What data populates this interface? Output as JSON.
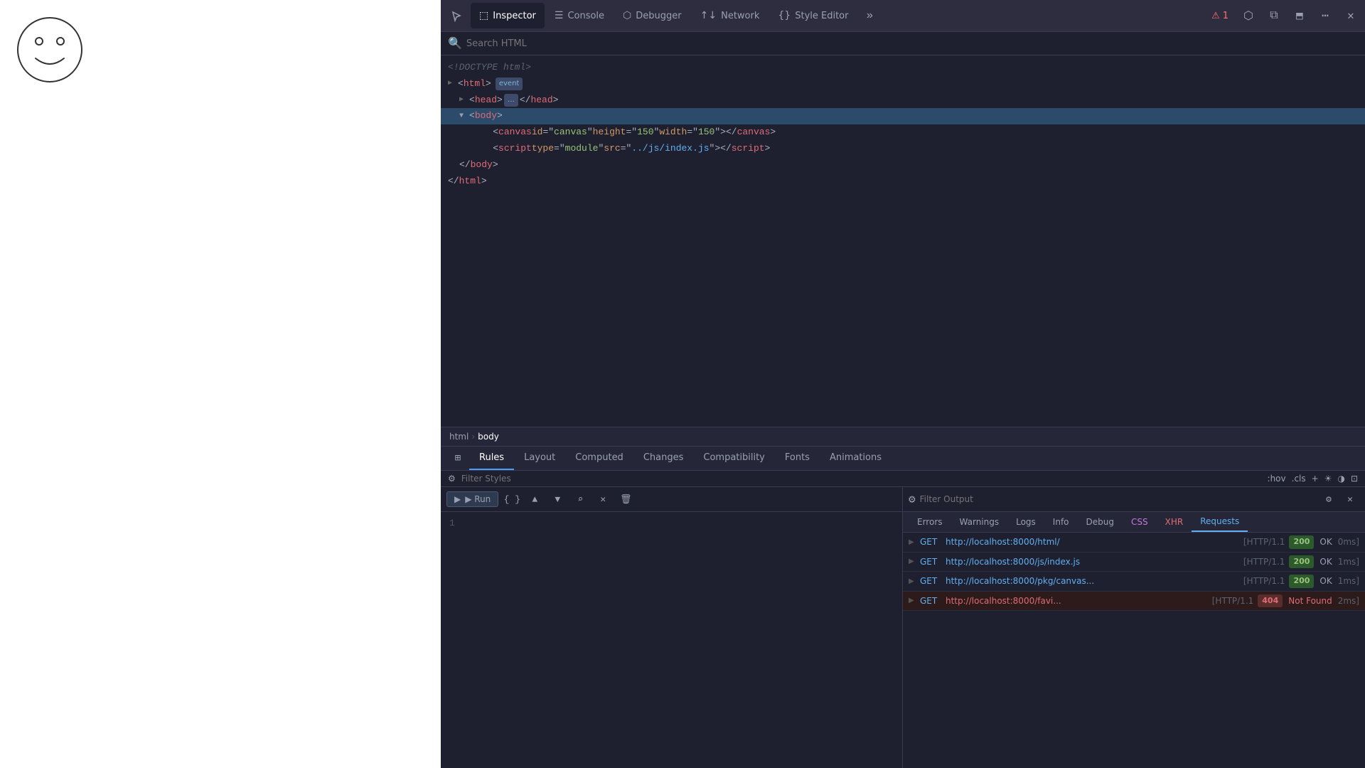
{
  "viewport": {
    "smiley_label": "smiley face"
  },
  "toolbar": {
    "tabs": [
      {
        "id": "inspector",
        "label": "Inspector",
        "icon": "⬚",
        "active": true
      },
      {
        "id": "console",
        "label": "Console",
        "icon": "☰"
      },
      {
        "id": "debugger",
        "label": "Debugger",
        "icon": "⬡"
      },
      {
        "id": "network",
        "label": "Network",
        "icon": "↑↓"
      },
      {
        "id": "style_editor",
        "label": "Style Editor",
        "icon": "{}"
      }
    ],
    "error_count": "1",
    "more_label": "⋯",
    "responsive_label": "⧉",
    "screenshot_label": "⬡",
    "dock_label": "⬒",
    "overflow_label": "»"
  },
  "inspector": {
    "search_placeholder": "Search HTML",
    "html_lines": [
      {
        "indent": 0,
        "content": "<!DOCTYPE html>",
        "type": "doctype"
      },
      {
        "indent": 0,
        "content_parts": [
          {
            "type": "bracket",
            "text": "<"
          },
          {
            "type": "tag",
            "text": "html"
          },
          {
            "type": "bracket",
            "text": ">"
          },
          {
            "type": "badge",
            "text": "event"
          }
        ]
      },
      {
        "indent": 1,
        "content_parts": [
          {
            "type": "arrow",
            "text": "▶"
          },
          {
            "type": "bracket",
            "text": "<"
          },
          {
            "type": "tag",
            "text": "head"
          },
          {
            "type": "bracket",
            "text": ">"
          },
          {
            "type": "ellipsis",
            "text": "…"
          },
          {
            "type": "bracket",
            "text": "</"
          },
          {
            "type": "tag",
            "text": "head"
          },
          {
            "type": "bracket",
            "text": ">"
          }
        ]
      },
      {
        "indent": 1,
        "selected": true,
        "content_parts": [
          {
            "type": "arrow_open",
            "text": "▼"
          },
          {
            "type": "bracket",
            "text": "<"
          },
          {
            "type": "tag",
            "text": "body"
          },
          {
            "type": "bracket",
            "text": ">"
          }
        ]
      },
      {
        "indent": 2,
        "content_parts": [
          {
            "type": "bracket",
            "text": "<"
          },
          {
            "type": "tag",
            "text": "canvas"
          },
          {
            "type": "space"
          },
          {
            "type": "attr_name",
            "text": "id"
          },
          {
            "type": "bracket",
            "text": "=\""
          },
          {
            "type": "attr_value",
            "text": "canvas"
          },
          {
            "type": "bracket",
            "text": "\""
          },
          {
            "type": "space"
          },
          {
            "type": "attr_name",
            "text": "height"
          },
          {
            "type": "bracket",
            "text": "=\""
          },
          {
            "type": "attr_value",
            "text": "150"
          },
          {
            "type": "bracket",
            "text": "\""
          },
          {
            "type": "space"
          },
          {
            "type": "attr_name",
            "text": "width"
          },
          {
            "type": "bracket",
            "text": "=\""
          },
          {
            "type": "attr_value",
            "text": "150"
          },
          {
            "type": "bracket",
            "text": "\">"
          },
          {
            "type": "bracket",
            "text": "</"
          },
          {
            "type": "tag",
            "text": "canvas"
          },
          {
            "type": "bracket",
            "text": ">"
          }
        ]
      },
      {
        "indent": 2,
        "content_parts": [
          {
            "type": "bracket",
            "text": "<"
          },
          {
            "type": "tag",
            "text": "script"
          },
          {
            "type": "space"
          },
          {
            "type": "attr_name",
            "text": "type"
          },
          {
            "type": "bracket",
            "text": "=\""
          },
          {
            "type": "attr_value",
            "text": "module"
          },
          {
            "type": "bracket",
            "text": "\""
          },
          {
            "type": "space"
          },
          {
            "type": "attr_name",
            "text": "src"
          },
          {
            "type": "bracket",
            "text": "=\""
          },
          {
            "type": "attr_value_link",
            "text": "../js/index.js"
          },
          {
            "type": "bracket",
            "text": "\">"
          },
          {
            "type": "bracket",
            "text": "</"
          },
          {
            "type": "tag",
            "text": "script"
          },
          {
            "type": "bracket",
            "text": ">"
          }
        ]
      },
      {
        "indent": 1,
        "content_parts": [
          {
            "type": "bracket",
            "text": "</"
          },
          {
            "type": "tag",
            "text": "body"
          },
          {
            "type": "bracket",
            "text": ">"
          }
        ]
      },
      {
        "indent": 0,
        "content_parts": [
          {
            "type": "bracket",
            "text": "</"
          },
          {
            "type": "tag",
            "text": "html"
          },
          {
            "type": "bracket",
            "text": ">"
          }
        ]
      }
    ],
    "breadcrumb": [
      {
        "label": "html",
        "active": false
      },
      {
        "label": "body",
        "active": true
      }
    ]
  },
  "css_panel": {
    "tabs": [
      {
        "id": "sidebar_icon",
        "label": "⊞",
        "type": "icon"
      },
      {
        "id": "rules",
        "label": "Rules",
        "active": true
      },
      {
        "id": "layout",
        "label": "Layout"
      },
      {
        "id": "computed",
        "label": "Computed"
      },
      {
        "id": "changes",
        "label": "Changes"
      },
      {
        "id": "compatibility",
        "label": "Compatibility"
      },
      {
        "id": "fonts",
        "label": "Fonts"
      },
      {
        "id": "animations",
        "label": "Animations"
      }
    ],
    "filter_placeholder": "Filter Styles",
    "pseudo_hov": ":hov",
    "pseudo_cls": ".cls",
    "add_label": "+",
    "light_label": "☀",
    "dark_label": "◑",
    "code_label": "⊡"
  },
  "console_panel": {
    "run_label": "▶ Run",
    "run_format": "{ }",
    "nav_up": "▲",
    "nav_down": "▼",
    "zoom": "⌕",
    "close": "✕",
    "trash": "🗑",
    "filter_placeholder": "Filter Output",
    "settings_label": "⚙",
    "close2_label": "✕",
    "code_line": "1",
    "tabs": [
      {
        "id": "errors",
        "label": "Errors"
      },
      {
        "id": "warnings",
        "label": "Warnings"
      },
      {
        "id": "logs",
        "label": "Logs"
      },
      {
        "id": "info",
        "label": "Info"
      },
      {
        "id": "debug",
        "label": "Debug"
      },
      {
        "id": "css",
        "label": "CSS"
      },
      {
        "id": "xhr",
        "label": "XHR"
      },
      {
        "id": "requests",
        "label": "Requests",
        "active": true
      }
    ],
    "network_rows": [
      {
        "method": "GET",
        "url": "http://localhost:8000/html/",
        "protocol": "[HTTP/1.1",
        "status_code": "200",
        "status_text": "OK",
        "time": "0ms]",
        "error": false
      },
      {
        "method": "GET",
        "url": "http://localhost:8000/js/index.js",
        "protocol": "[HTTP/1.1",
        "status_code": "200",
        "status_text": "OK",
        "time": "1ms]",
        "error": false
      },
      {
        "method": "GET",
        "url": "http://localhost:8000/pkg/canvas...",
        "protocol": "[HTTP/1.1",
        "status_code": "200",
        "status_text": "OK",
        "time": "1ms]",
        "error": false
      },
      {
        "method": "GET",
        "url": "http://localhost:8000/favi...",
        "protocol": "[HTTP/1.1",
        "status_code": "404",
        "status_text": "Not Found",
        "time": "2ms]",
        "error": true
      }
    ]
  }
}
